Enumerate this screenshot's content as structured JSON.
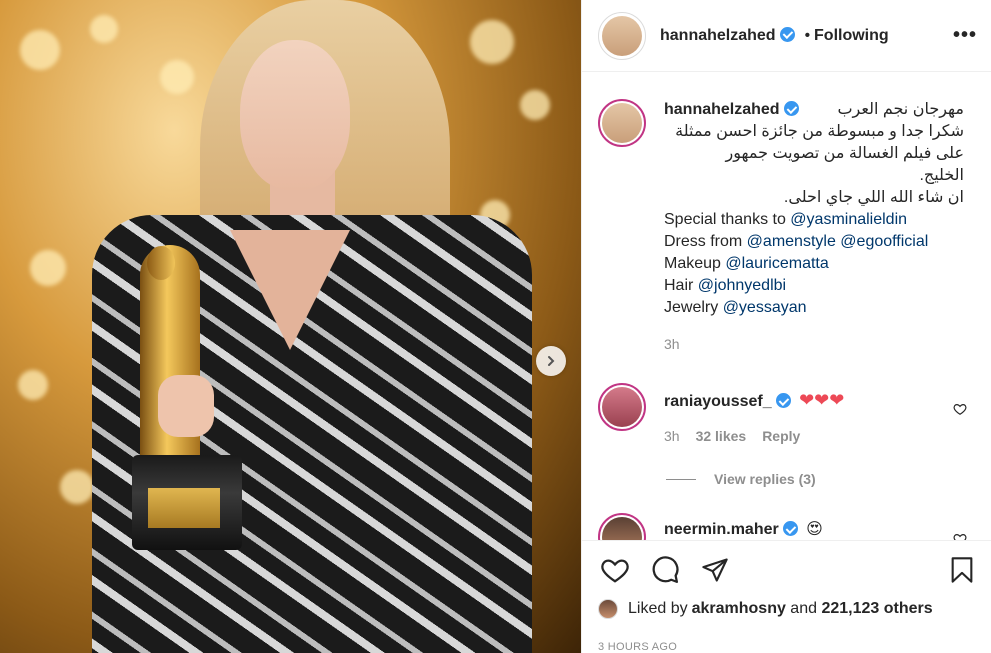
{
  "post": {
    "author": "hannahelzahed",
    "separator": "•",
    "following_label": "Following",
    "more_label": "•••"
  },
  "caption": {
    "author": "hannahelzahed",
    "arabic_lines": [
      "مهرجان نجم العرب",
      "شكرا جدا و مبسوطة من جائزة احسن ممثلة",
      "على فيلم الغسالة من تصويت جمهور",
      "الخليج.",
      "ان شاء الله اللي جاي احلى."
    ],
    "credits": [
      {
        "prefix": "Special thanks to ",
        "mentions": [
          "@yasminalieldin"
        ]
      },
      {
        "prefix": "Dress from ",
        "mentions": [
          "@amenstyle",
          "@egoofficial"
        ]
      },
      {
        "prefix": "Makeup ",
        "mentions": [
          "@lauricematta"
        ]
      },
      {
        "prefix": "Hair ",
        "mentions": [
          "@johnyedlbi"
        ]
      },
      {
        "prefix": "Jewelry ",
        "mentions": [
          "@yessayan"
        ]
      }
    ],
    "time": "3h"
  },
  "comments": [
    {
      "author": "raniayoussef_",
      "text": "❤❤❤",
      "time": "3h",
      "likes": "32 likes",
      "reply_label": "Reply"
    },
    {
      "author": "neermin.maher",
      "text": "😍"
    }
  ],
  "view_replies_label": "View replies (3)",
  "likes": {
    "prefix": "Liked by ",
    "user": "akramhosny",
    "middle": " and ",
    "count": "221,123 others"
  },
  "timestamp": "3 HOURS AGO",
  "colors": {
    "verified": "#3897f0",
    "mention": "#00376b",
    "meta": "#8e8e8e",
    "heart": "#ed4956"
  },
  "icons": {
    "like": "heart-icon",
    "comment": "comment-icon",
    "share": "paper-plane-icon",
    "save": "bookmark-icon",
    "next": "chevron-right-icon"
  }
}
